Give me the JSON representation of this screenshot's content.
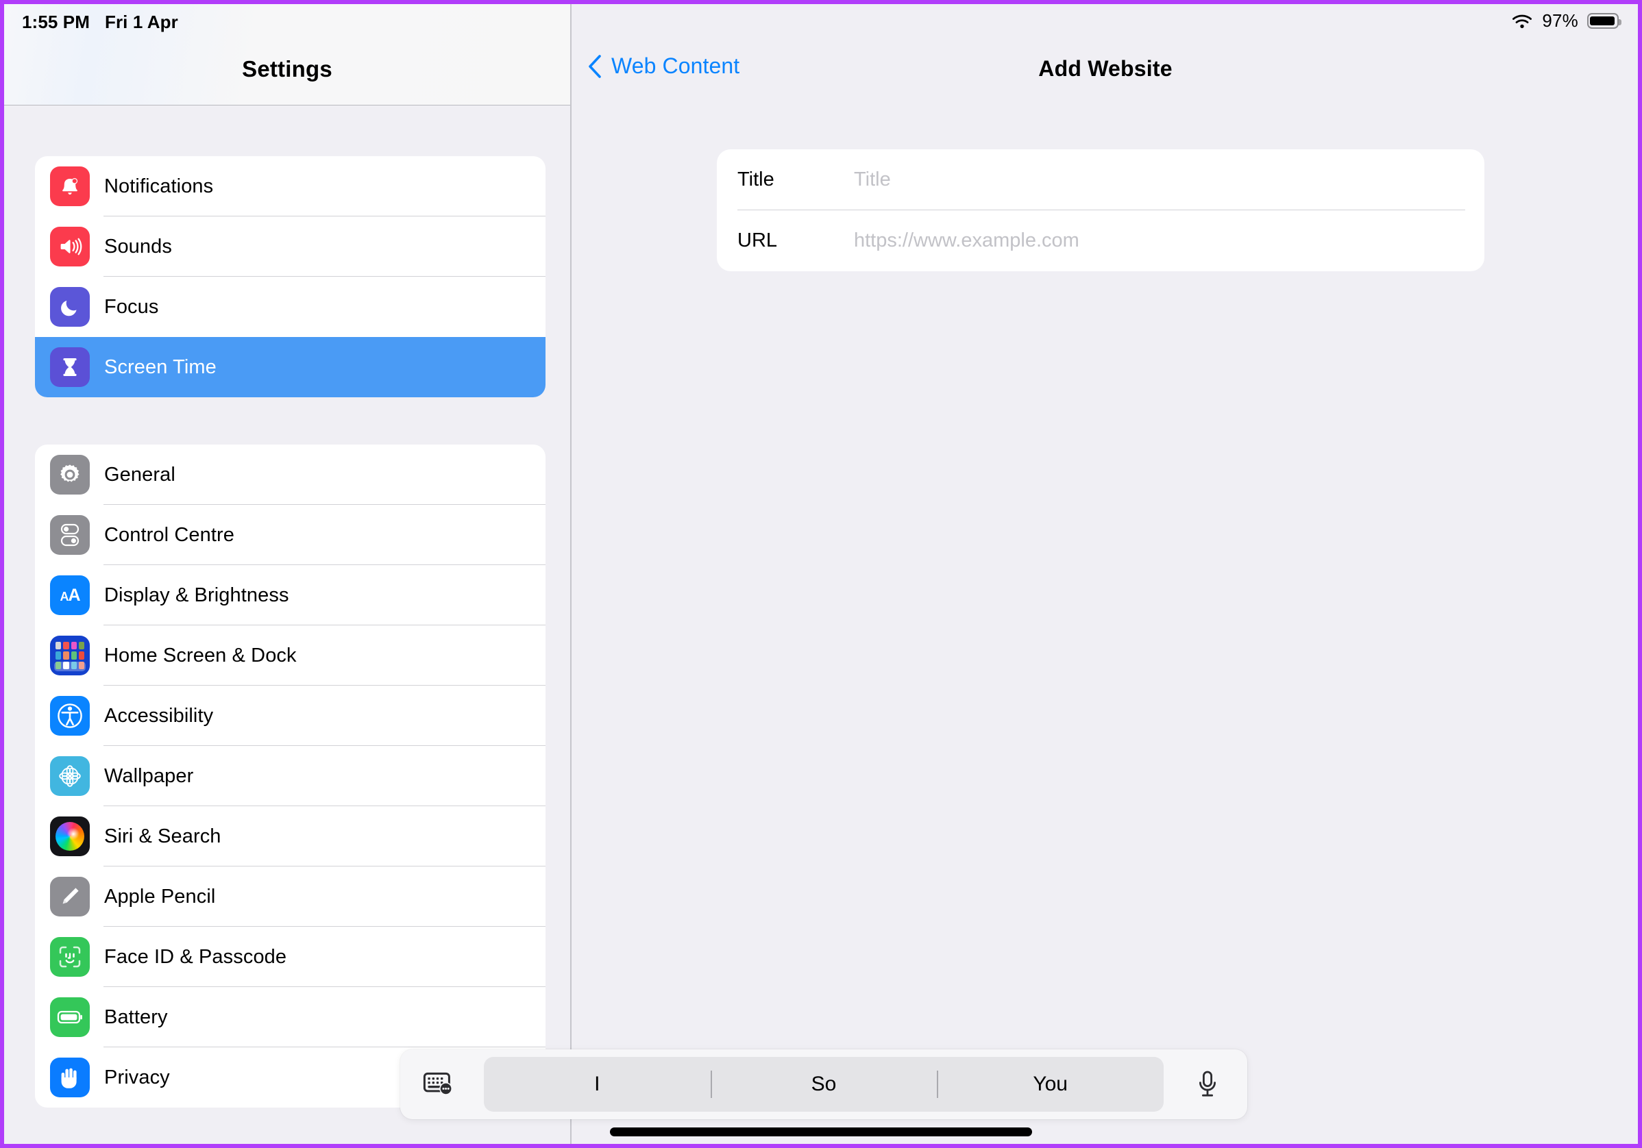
{
  "status_bar": {
    "time": "1:55 PM",
    "date": "Fri 1 Apr",
    "wifi_icon": "wifi-icon",
    "battery_percent": "97%",
    "battery_icon": "battery-full-icon"
  },
  "sidebar": {
    "title": "Settings",
    "groups": [
      {
        "items": [
          {
            "label": "Notifications",
            "icon": "bell-icon",
            "selected": false
          },
          {
            "label": "Sounds",
            "icon": "speaker-icon",
            "selected": false
          },
          {
            "label": "Focus",
            "icon": "moon-icon",
            "selected": false
          },
          {
            "label": "Screen Time",
            "icon": "hourglass-icon",
            "selected": true
          }
        ]
      },
      {
        "items": [
          {
            "label": "General",
            "icon": "gear-icon",
            "selected": false
          },
          {
            "label": "Control Centre",
            "icon": "toggles-icon",
            "selected": false
          },
          {
            "label": "Display & Brightness",
            "icon": "aa-text-size-icon",
            "selected": false
          },
          {
            "label": "Home Screen & Dock",
            "icon": "home-screen-icon",
            "selected": false
          },
          {
            "label": "Accessibility",
            "icon": "accessibility-icon",
            "selected": false
          },
          {
            "label": "Wallpaper",
            "icon": "flower-icon",
            "selected": false
          },
          {
            "label": "Siri & Search",
            "icon": "siri-orb-icon",
            "selected": false
          },
          {
            "label": "Apple Pencil",
            "icon": "pencil-icon",
            "selected": false
          },
          {
            "label": "Face ID & Passcode",
            "icon": "face-id-icon",
            "selected": false
          },
          {
            "label": "Battery",
            "icon": "battery-icon",
            "selected": false
          },
          {
            "label": "Privacy",
            "icon": "hand-icon",
            "selected": false
          }
        ]
      }
    ]
  },
  "detail": {
    "back_label": "Web Content",
    "back_icon": "chevron-left-icon",
    "title": "Add Website",
    "form": {
      "fields": [
        {
          "label": "Title",
          "value": "",
          "placeholder": "Title"
        },
        {
          "label": "URL",
          "value": "",
          "placeholder": "https://www.example.com"
        }
      ]
    }
  },
  "keyboard_toolbar": {
    "switch_icon": "keyboard-ellipsis-icon",
    "dictation_icon": "microphone-icon",
    "suggestions": [
      "I",
      "So",
      "You"
    ]
  },
  "colors": {
    "frame": "#b13dfa",
    "accent_blue": "#0a84ff",
    "selected_row": "#4a9bf5",
    "background": "#f0eff4",
    "card": "#ffffff"
  }
}
